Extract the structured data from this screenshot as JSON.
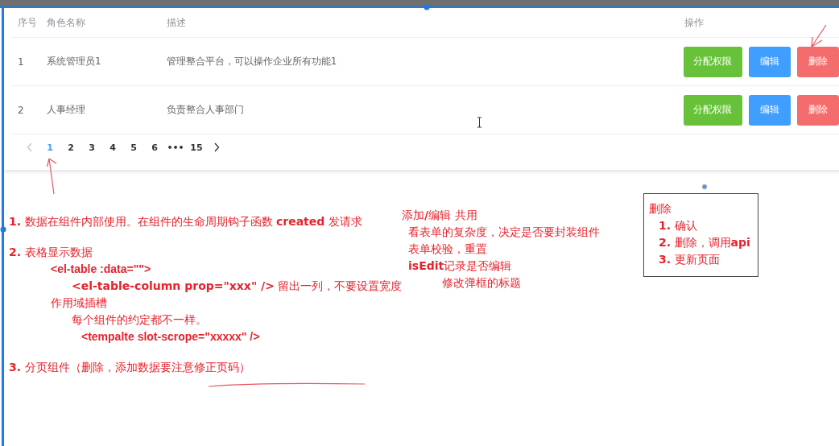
{
  "table": {
    "columns": [
      "序号",
      "角色名称",
      "描述",
      "操作"
    ],
    "rows": [
      {
        "index": "1",
        "name": "系统管理员1",
        "description": "管理整合平台，可以操作企业所有功能1",
        "actions": [
          {
            "label": "分配权限",
            "kind": "success"
          },
          {
            "label": "编辑",
            "kind": "primary"
          },
          {
            "label": "删除",
            "kind": "danger"
          }
        ]
      },
      {
        "index": "2",
        "name": "人事经理",
        "description": "负责整合人事部门",
        "actions": [
          {
            "label": "分配权限",
            "kind": "success"
          },
          {
            "label": "编辑",
            "kind": "primary"
          },
          {
            "label": "删除",
            "kind": "danger"
          }
        ]
      }
    ]
  },
  "pagination": {
    "prev_disabled": true,
    "pages": [
      {
        "label": "1",
        "selected": true
      },
      {
        "label": "2",
        "selected": false
      },
      {
        "label": "3",
        "selected": false
      },
      {
        "label": "4",
        "selected": false
      },
      {
        "label": "5",
        "selected": false
      },
      {
        "label": "6",
        "selected": false
      },
      {
        "label": "•••",
        "selected": false
      },
      {
        "label": "15",
        "selected": false
      }
    ],
    "next_disabled": false
  },
  "notes_left": [
    {
      "text": "**1.** 数据在组件内部使用。在组件的生命周期钩子函数 **created** 发请求",
      "kind": "text"
    },
    {
      "text": "**2.** 表格显示数据",
      "kind": "text",
      "children": [
        {
          "text": "<el-table :data=\"\">",
          "kind": "code",
          "children": [
            {
              "text": "**<el-table-column prop=\"xxx\" />** 留出一列，不要设置宽度",
              "kind": "text"
            }
          ]
        },
        {
          "text": "作用域插槽",
          "kind": "text",
          "children": [
            {
              "text": "每个组件的约定都不一样。",
              "kind": "text",
              "children": [
                {
                  "text": "<tempalte slot-scrope=\"xxxxx\" />",
                  "kind": "code"
                }
              ]
            }
          ]
        }
      ]
    },
    {
      "text": "**3.** 分页组件（删除，添加数据要注意修正页码）",
      "kind": "text"
    }
  ],
  "notes_middle": [
    {
      "text": "添加**/**编辑 共用",
      "kind": "text",
      "children": [
        {
          "text": "看表单的复杂度，决定是否要封装组件",
          "kind": "text"
        },
        {
          "text": "表单校验，重置",
          "kind": "text"
        },
        {
          "text": "**isEdit**记录是否编辑",
          "kind": "text",
          "children": [
            {
              "text": "修改弹框的标题",
              "kind": "text"
            }
          ]
        }
      ]
    }
  ],
  "notes_box": [
    {
      "text": "删除",
      "kind": "text",
      "children": [
        {
          "text": "**1.** 确认",
          "kind": "text"
        },
        {
          "text": "**2.** 删除，调用**api**",
          "kind": "text"
        },
        {
          "text": "**3.** 更新页面",
          "kind": "text"
        }
      ]
    }
  ]
}
